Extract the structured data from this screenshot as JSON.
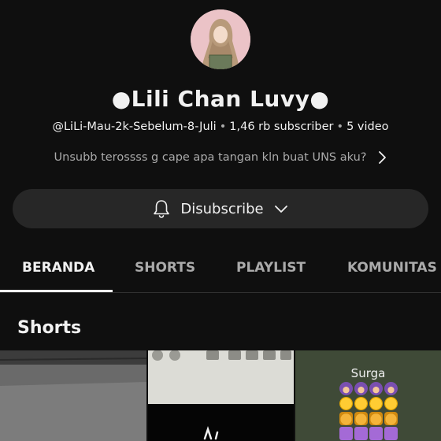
{
  "channel": {
    "name": "●Lili Chan Luvy●",
    "handle": "@LiLi-Mau-2k-Sebelum-8-Juli",
    "subscribers": "1,46 rb subscriber",
    "videos": "5 video",
    "separator": "•",
    "description": "Unsubb terossss g cape apa tangan kln buat UNS aku?"
  },
  "subscribe_button": {
    "label": "Disubscribe"
  },
  "tabs": [
    {
      "label": "BERANDA",
      "active": true
    },
    {
      "label": "SHORTS",
      "active": false
    },
    {
      "label": "PLAYLIST",
      "active": false
    },
    {
      "label": "KOMUNITAS",
      "active": false
    }
  ],
  "sections": {
    "shorts_title": "Shorts"
  },
  "shorts": [
    {
      "overlay_text": ""
    },
    {
      "overlay_text": ""
    },
    {
      "overlay_text": "Surga"
    }
  ],
  "colors": {
    "background": "#0f0f0f",
    "button_bg": "#272727",
    "text_primary": "#f1f1f1",
    "text_secondary": "#aaaaaa"
  },
  "icons": {
    "avatar": "hijab-girl-avatar",
    "description_more": "chevron-right-icon",
    "bell": "bell-icon",
    "dropdown": "chevron-down-icon"
  }
}
